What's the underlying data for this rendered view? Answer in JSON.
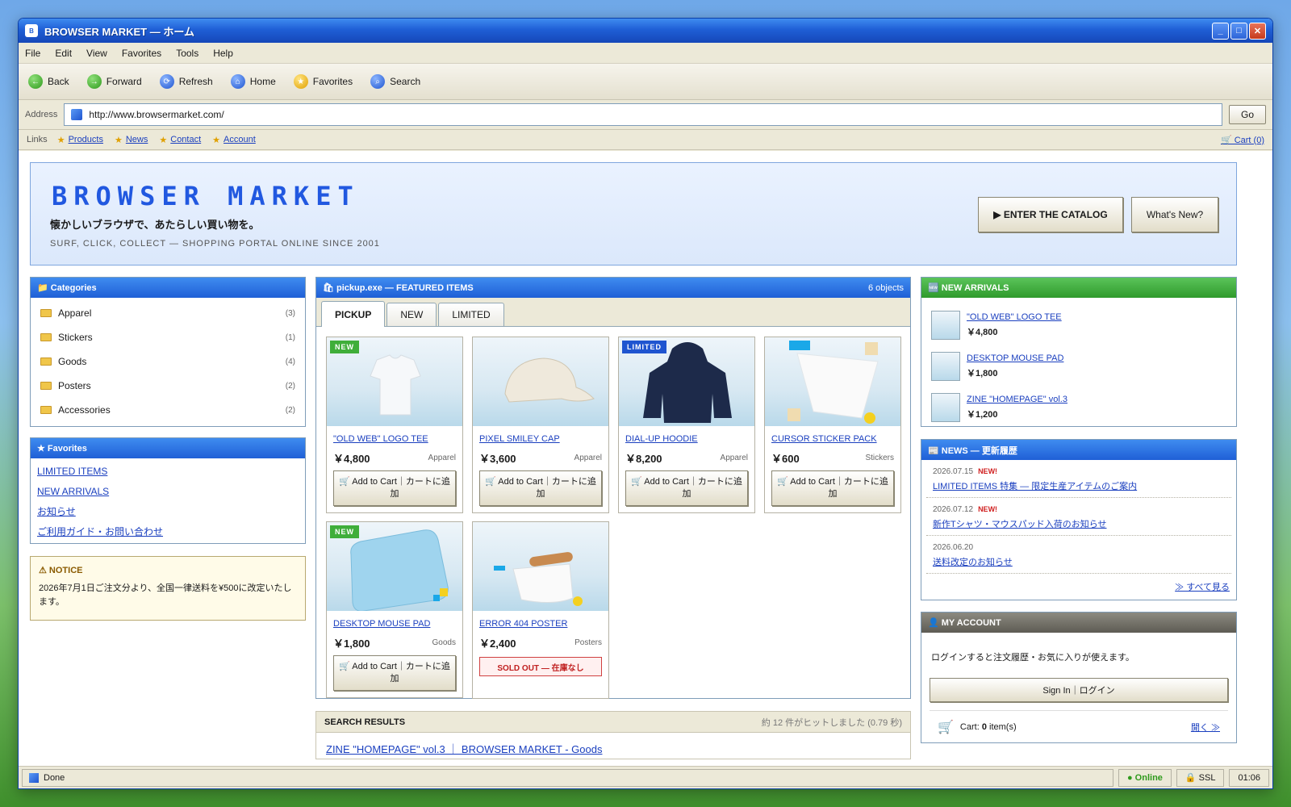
{
  "window": {
    "title": "BROWSER MARKET — ホーム",
    "icon_letter": "B",
    "min": "_",
    "max": "□",
    "close": "✕"
  },
  "menu": [
    "File",
    "Edit",
    "View",
    "Favorites",
    "Tools",
    "Help"
  ],
  "toolbar": [
    {
      "label": "Back",
      "glyph": "←"
    },
    {
      "label": "Forward",
      "glyph": "→"
    },
    {
      "label": "Refresh",
      "glyph": "⟳"
    },
    {
      "label": "Home",
      "glyph": "⌂"
    },
    {
      "label": "Favorites",
      "glyph": "★"
    },
    {
      "label": "Search",
      "glyph": "⌕"
    }
  ],
  "address": {
    "label": "Address",
    "url": "http://www.browsermarket.com/",
    "go": "Go"
  },
  "links": {
    "label": "Links",
    "items": [
      "Products",
      "News",
      "Contact",
      "Account"
    ],
    "cart": "🛒 Cart (0)"
  },
  "banner": {
    "logo": "BROWSER MARKET",
    "tagline": "懐かしいブラウザで、あたらしい買い物を。",
    "subtitle": "SURF, CLICK, COLLECT — SHOPPING PORTAL ONLINE SINCE 2001",
    "catalog_btn": "▶ ENTER THE CATALOG",
    "new_btn": "What's New?"
  },
  "categories": {
    "title": "📁 Categories",
    "items": [
      {
        "name": "Apparel",
        "count": "(3)"
      },
      {
        "name": "Stickers",
        "count": "(1)"
      },
      {
        "name": "Goods",
        "count": "(4)"
      },
      {
        "name": "Posters",
        "count": "(2)"
      },
      {
        "name": "Accessories",
        "count": "(2)"
      }
    ]
  },
  "favorites": {
    "title": "★ Favorites",
    "items": [
      "LIMITED ITEMS",
      "NEW ARRIVALS",
      "お知らせ",
      "ご利用ガイド・お問い合わせ"
    ]
  },
  "notice": {
    "title": "⚠ NOTICE",
    "text": "2026年7月1日ご注文分より、全国一律送料を¥500に改定いたします。"
  },
  "featured": {
    "title": "🛍 pickup.exe — FEATURED ITEMS",
    "count": "6 objects",
    "tabs": [
      "PICKUP",
      "NEW",
      "LIMITED"
    ],
    "add_label": "🛒 Add to Cart｜カートに追加",
    "sold_label": "SOLD OUT — 在庫なし",
    "items": [
      {
        "name": "\"OLD WEB\" LOGO TEE",
        "price": "￥4,800",
        "category": "Apparel",
        "badge": "NEW"
      },
      {
        "name": "PIXEL SMILEY CAP",
        "price": "￥3,600",
        "category": "Apparel",
        "badge": ""
      },
      {
        "name": "DIAL-UP HOODIE",
        "price": "￥8,200",
        "category": "Apparel",
        "badge": "LIMITED"
      },
      {
        "name": "CURSOR STICKER PACK",
        "price": "￥600",
        "category": "Stickers",
        "badge": ""
      },
      {
        "name": "DESKTOP MOUSE PAD",
        "price": "￥1,800",
        "category": "Goods",
        "badge": "NEW"
      },
      {
        "name": "ERROR 404 POSTER",
        "price": "￥2,400",
        "category": "Posters",
        "badge": ""
      }
    ]
  },
  "search": {
    "title": "SEARCH RESULTS",
    "stats": "約 12 件がヒットしました (0.79 秒)",
    "first_result": "ZINE \"HOMEPAGE\" vol.3 ｜ BROWSER MARKET - Goods"
  },
  "arrivals": {
    "title": "🆕 NEW ARRIVALS",
    "items": [
      {
        "name": "\"OLD WEB\" LOGO TEE",
        "price": "￥4,800"
      },
      {
        "name": "DESKTOP MOUSE PAD",
        "price": "￥1,800"
      },
      {
        "name": "ZINE \"HOMEPAGE\" vol.3",
        "price": "￥1,200"
      }
    ]
  },
  "news": {
    "title": "📰 NEWS — 更新履歴",
    "new_tag": "NEW!",
    "items": [
      {
        "date": "2026.07.15",
        "new": true,
        "text": "LIMITED ITEMS 特集 — 限定生産アイテムのご案内"
      },
      {
        "date": "2026.07.12",
        "new": true,
        "text": "新作Tシャツ・マウスパッド入荷のお知らせ"
      },
      {
        "date": "2026.06.20",
        "new": false,
        "text": "送料改定のお知らせ"
      }
    ],
    "view_all": "≫ すべて見る"
  },
  "account": {
    "title": "👤 MY ACCOUNT",
    "text": "ログインすると注文履歴・お気に入りが使えます。",
    "signin": "Sign In｜ログイン",
    "cart_prefix": "Cart: ",
    "cart_count": "0",
    "cart_suffix": " item(s)",
    "open": "開く ≫"
  },
  "status": {
    "main": "Done",
    "online": "● Online",
    "ssl": "🔒 SSL",
    "time": "01:06"
  }
}
